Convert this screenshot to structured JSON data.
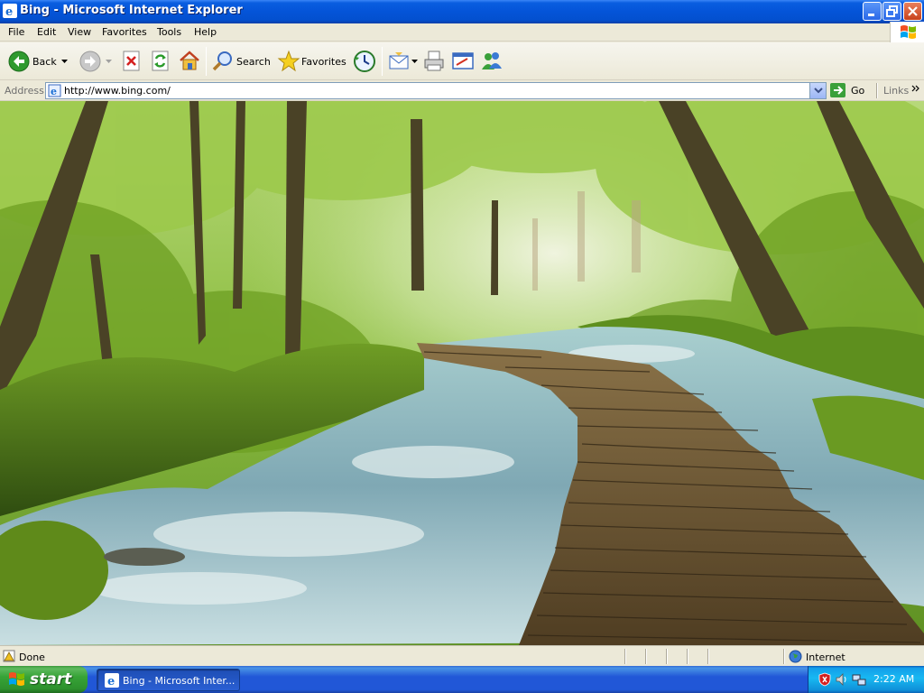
{
  "window": {
    "title": "Bing - Microsoft Internet Explorer"
  },
  "menu": {
    "items": [
      "File",
      "Edit",
      "View",
      "Favorites",
      "Tools",
      "Help"
    ]
  },
  "toolbar": {
    "back_label": "Back",
    "search_label": "Search",
    "favorites_label": "Favorites"
  },
  "address": {
    "label": "Address",
    "url": "http://www.bing.com/",
    "go_label": "Go",
    "links_label": "Links"
  },
  "status": {
    "text": "Done",
    "zone": "Internet"
  },
  "taskbar": {
    "start_label": "start",
    "task_label": "Bing - Microsoft Inter...",
    "clock": "2:22 AM"
  },
  "colors": {
    "titlebar": "#0454d8",
    "taskbar": "#2157d7",
    "start": "#37a337",
    "tray": "#18b9f2"
  }
}
